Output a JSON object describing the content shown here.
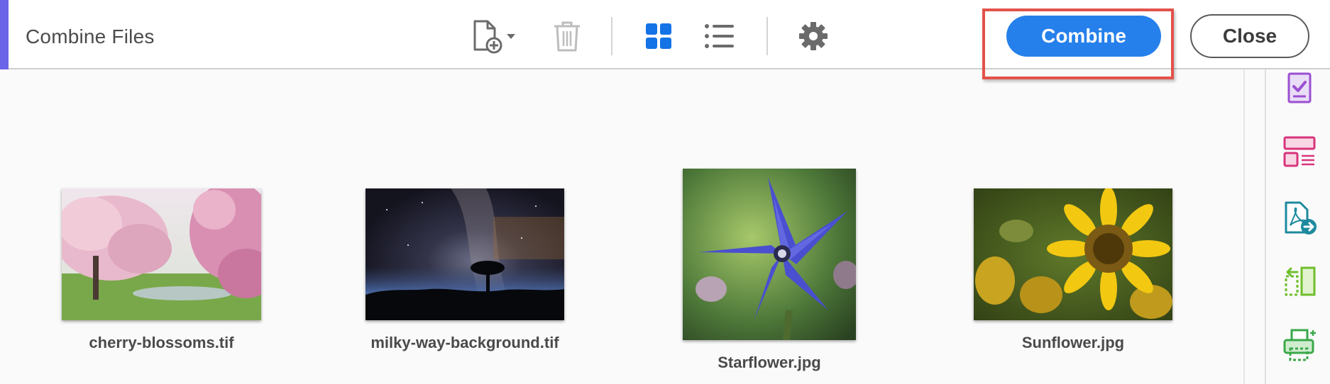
{
  "window": {
    "title": "Combine Files"
  },
  "toolbar": {
    "add_files_icon": "add-file-icon",
    "delete_icon": "trash-icon",
    "grid_view_icon": "grid-view-icon",
    "list_view_icon": "list-view-icon",
    "settings_icon": "gear-icon",
    "combine_label": "Combine",
    "close_label": "Close"
  },
  "colors": {
    "accent": "#6a64e8",
    "primary_button": "#2680eb",
    "highlight": "#e2524a"
  },
  "files": [
    {
      "name": "cherry-blossoms.tif"
    },
    {
      "name": "milky-way-background.tif"
    },
    {
      "name": "Starflower.jpg"
    },
    {
      "name": "Sunflower.jpg"
    }
  ],
  "right_panel": {
    "tools": [
      "protect-icon",
      "organize-pages-icon",
      "export-pdf-icon",
      "compare-files-icon",
      "print-production-icon"
    ]
  }
}
